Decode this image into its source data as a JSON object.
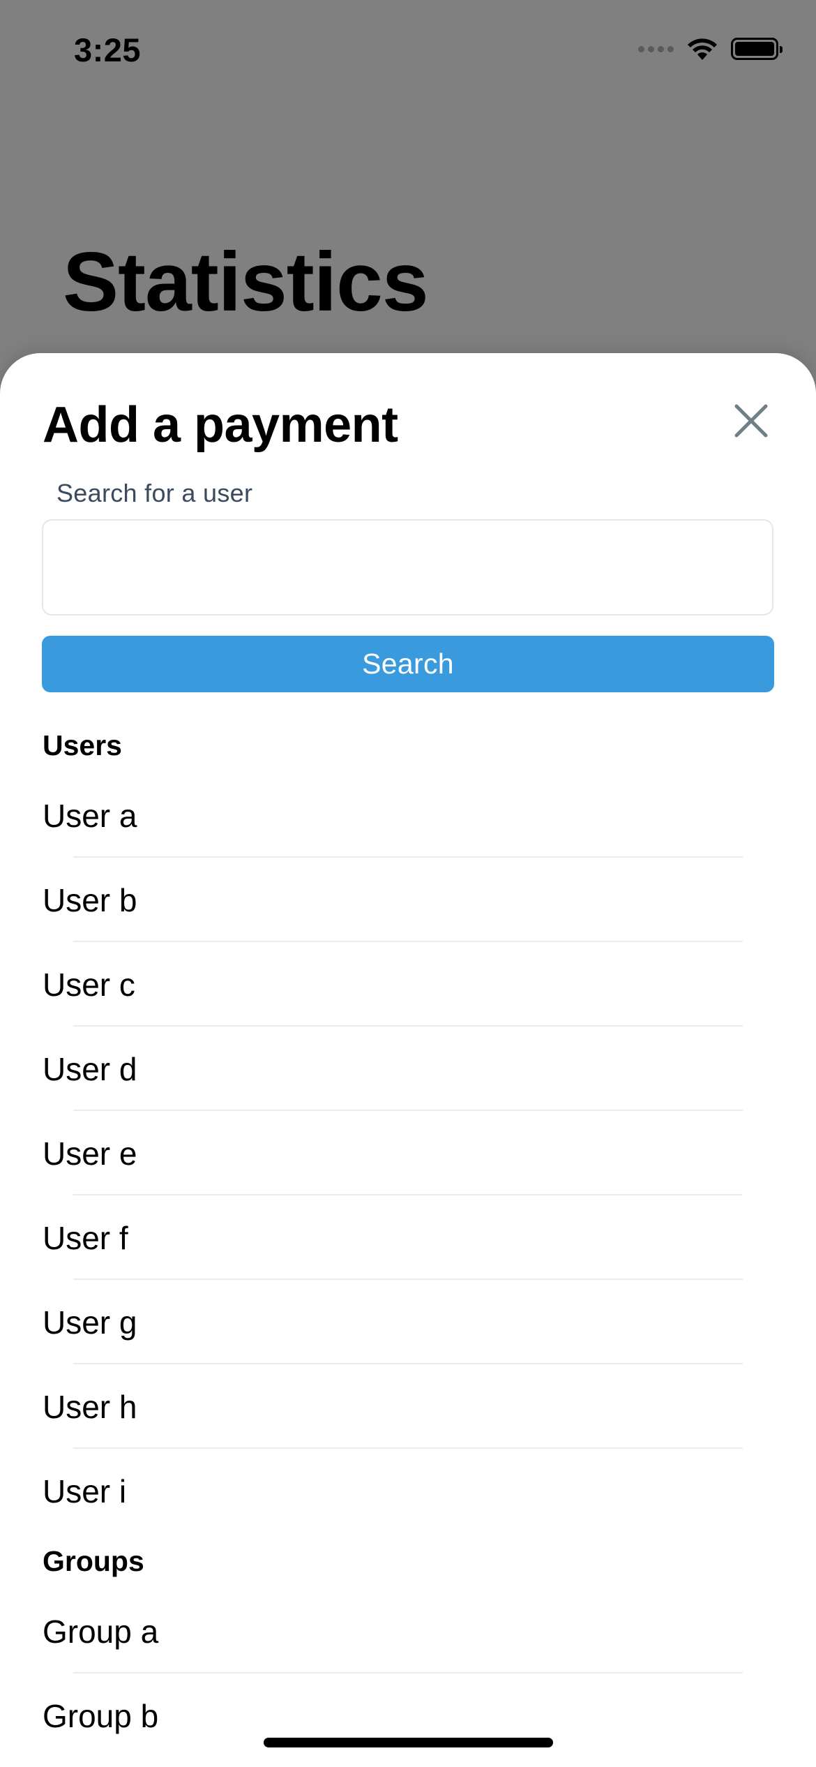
{
  "status_bar": {
    "time": "3:25"
  },
  "background": {
    "title": "Statistics"
  },
  "sheet": {
    "title": "Add a payment",
    "search": {
      "label": "Search for a user",
      "value": "",
      "placeholder": "",
      "button_label": "Search"
    },
    "sections": [
      {
        "header": "Users",
        "items": [
          "User a",
          "User b",
          "User c",
          "User d",
          "User e",
          "User f",
          "User g",
          "User h",
          "User i"
        ]
      },
      {
        "header": "Groups",
        "items": [
          "Group a",
          "Group b"
        ]
      }
    ]
  },
  "colors": {
    "accent": "#3a9ade",
    "overlay": "#808080",
    "label": "#3b4a5c"
  },
  "icons": {
    "close": "close-icon",
    "wifi": "wifi-icon",
    "battery": "battery-icon",
    "signal": "cellular-signal-icon"
  }
}
